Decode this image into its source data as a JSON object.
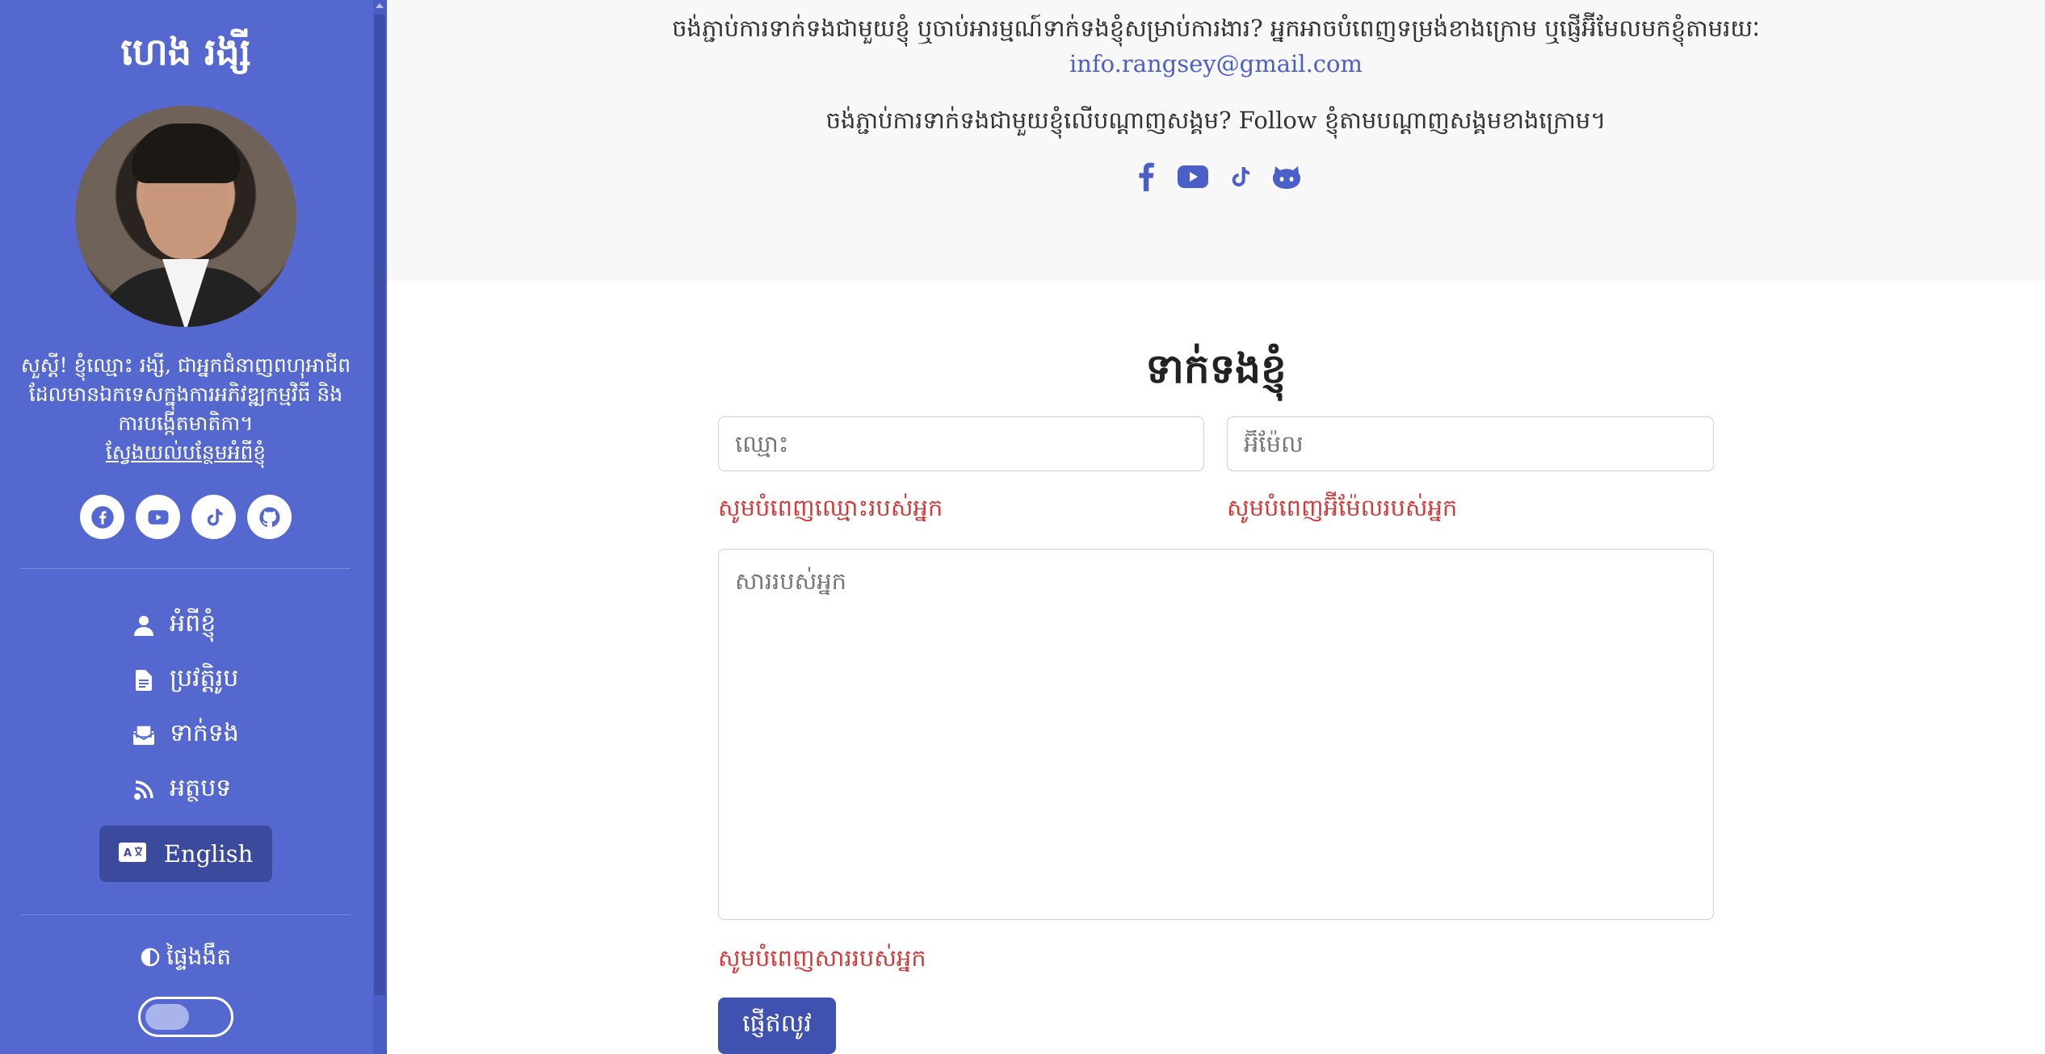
{
  "sidebar": {
    "site_name": "ហេង រង្សី",
    "bio": "សួស្តី! ខ្ញុំឈ្មោះ រង្សី, ជាអ្នកជំនាញពហុអាជីពដែលមានឯកទេសក្នុងការអភិវឌ្ឍកម្មវិធី និងការបង្កើតមាតិកា។",
    "bio_link": "ស្វែងយល់បន្ថែមអំពីខ្ញុំ",
    "social": [
      "facebook-icon",
      "youtube-icon",
      "tiktok-icon",
      "github-icon"
    ],
    "nav": [
      {
        "label": "អំពីខ្ញុំ",
        "icon": "user-icon"
      },
      {
        "label": "ប្រវត្តិរូប",
        "icon": "file-icon"
      },
      {
        "label": "ទាក់ទង",
        "icon": "envelope-open-icon"
      },
      {
        "label": "អត្ថបទ",
        "icon": "rss-icon"
      }
    ],
    "language_button": "English",
    "theme_label": "ផ្ទៃងងឹត",
    "theme_dark_enabled": false
  },
  "contact": {
    "line1": "ចង់ភ្ជាប់ការទាក់ទងជាមួយខ្ញុំ ឬចាប់អារម្មណ៍ទាក់ទងខ្ញុំសម្រាប់ការងារ? អ្នកអាចបំពេញទម្រង់ខាងក្រោម ឬផ្ញើអ៊ីមែលមកខ្ញុំតាមរយៈ",
    "email": "info.rangsey@gmail.com",
    "line2": "ចង់ភ្ជាប់ការទាក់ទងជាមួយខ្ញុំលើបណ្តាញសង្គម? Follow ខ្ញុំតាមបណ្តាញសង្គមខាងក្រោម។",
    "social": [
      "facebook-icon",
      "youtube-icon",
      "tiktok-icon",
      "github-icon"
    ]
  },
  "form": {
    "title": "ទាក់ទងខ្ញុំ",
    "name_placeholder": "ឈ្មោះ",
    "email_placeholder": "អ៊ីម៉ែល",
    "name_error": "សូមបំពេញឈ្មោះរបស់អ្នក",
    "email_error": "សូមបំពេញអ៊ីម៉ែលរបស់អ្នក",
    "message_placeholder": "សាររបស់អ្នក",
    "message_error": "សូមបំពេញសាររបស់អ្នក",
    "submit": "ផ្ញើឥលូវ"
  },
  "colors": {
    "sidebar_bg": "#5468d0",
    "accent": "#4b5fc9",
    "button_bg": "#4052b0",
    "error": "#d33a3a"
  }
}
